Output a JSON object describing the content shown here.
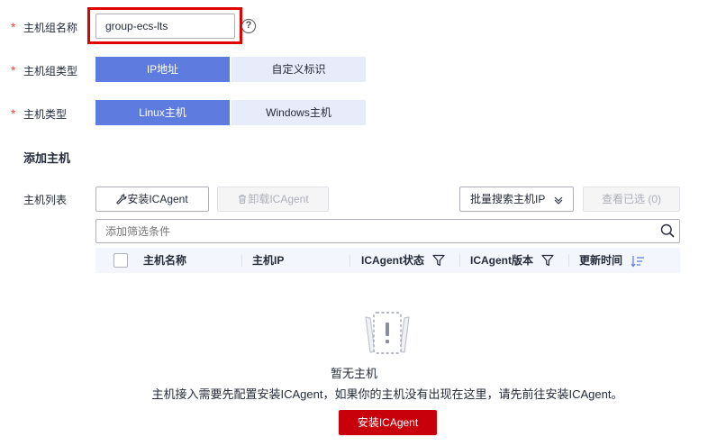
{
  "form": {
    "required_mark": "*",
    "host_group_name": {
      "label": "主机组名称",
      "value": "group-ecs-lts",
      "help_glyph": "?"
    },
    "host_group_type": {
      "label": "主机组类型",
      "options": [
        "IP地址",
        "自定义标识"
      ],
      "selected": "IP地址"
    },
    "host_type": {
      "label": "主机类型",
      "options": [
        "Linux主机",
        "Windows主机"
      ],
      "selected": "Linux主机"
    }
  },
  "add_host": {
    "title": "添加主机",
    "host_list_label": "主机列表",
    "install_button": "安装ICAgent",
    "uninstall_button": "卸载ICAgent",
    "batch_search": "批量搜索主机IP",
    "view_selected": "查看已选 (0)",
    "filter_placeholder": "添加筛选条件",
    "columns": [
      "主机名称",
      "主机IP",
      "ICAgent状态",
      "ICAgent版本",
      "更新时间"
    ]
  },
  "empty_state": {
    "title": "暂无主机",
    "message": "主机接入需要先配置安装ICAgent，如果你的主机没有出现在这里，请先前往安装ICAgent。",
    "button": "安装ICAgent"
  },
  "colors": {
    "required": "#e54545",
    "highlight": "#e00000",
    "segment_active": "#5e7ce0",
    "segment_inactive": "#e8ebf9",
    "primary": "#c7000b",
    "table_header": "#f3f6fc"
  },
  "icons": [
    "help-icon",
    "wrench-icon",
    "trash-icon",
    "chevron-down-icon",
    "search-icon",
    "filter-icon",
    "sort-icon",
    "empty-box-icon"
  ]
}
